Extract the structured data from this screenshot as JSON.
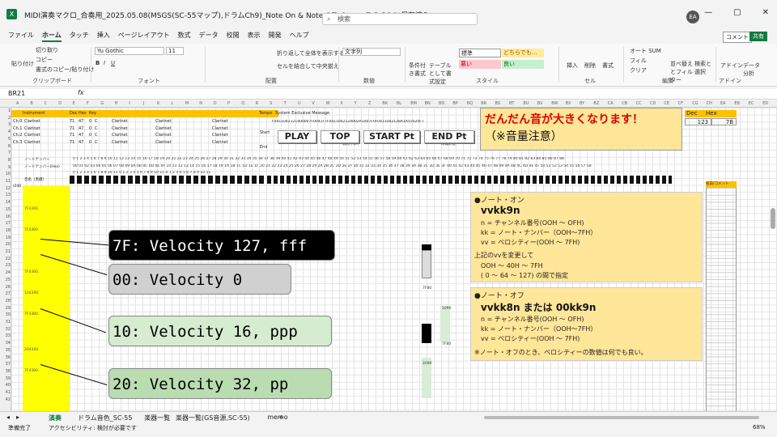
{
  "window": {
    "title": "MIDI演奏マクロ_合奏用_2025.05.08(MSGS(SC-55マップ),ドラムCh9)_Note On & Note Off.xlsm • この PC に保存済み",
    "search_placeholder": "検索",
    "user_initials": "EA"
  },
  "menu": {
    "tabs": [
      "ファイル",
      "ホーム",
      "タッチ",
      "挿入",
      "ページレイアウト",
      "数式",
      "データ",
      "校閲",
      "表示",
      "開発",
      "ヘルプ"
    ],
    "active": "ホーム",
    "comment_label": "コメント",
    "share_label": "共有"
  },
  "ribbon": {
    "paste": "貼り付け",
    "cut": "切り取り",
    "copy": "コピー",
    "format_painter": "書式のコピー/貼り付け",
    "clipboard": "クリップボード",
    "font_name": "Yu Gothic",
    "font_size": "11",
    "font_group": "フォント",
    "wrap_text": "折り返して全体を表示する",
    "merge_center": "セルを結合して中央揃え",
    "alignment": "配置",
    "number_format": "文字列",
    "number": "数値",
    "cond_format": "条件付き書式",
    "table_format": "テーブルとして書式設定",
    "style_standard": "標準",
    "style_neutral": "どちらでも...",
    "style_bad": "悪い",
    "style_good": "良い",
    "style": "スタイル",
    "insert": "挿入",
    "delete": "削除",
    "format": "書式",
    "cells": "セル",
    "autosum": "オート SUM",
    "fill": "フィル",
    "clear": "クリア",
    "sort_filter": "並べ替えとフィルター",
    "find_select": "検索と選択",
    "editing": "編集",
    "addin": "アドイン",
    "data_analysis": "データ分析"
  },
  "formula": {
    "cell_ref": "BR21",
    "fx": "fx",
    "content": ""
  },
  "sheet": {
    "col_headers": [
      "A",
      "B",
      "C",
      "D",
      "E",
      "F",
      "G",
      "H",
      "I",
      "J",
      "K",
      "L",
      "M",
      "N",
      "O",
      "P",
      "Q",
      "R",
      "S",
      "T",
      "U",
      "V",
      "W",
      "X",
      "Y",
      "Z",
      "BK",
      "BL",
      "BM",
      "BN",
      "BO",
      "BP",
      "BQ",
      "BR",
      "BS",
      "BT",
      "BU",
      "BV",
      "BW",
      "BX",
      "BY",
      "BZ",
      "CA",
      "CB",
      "CC",
      "CD",
      "CE",
      "CF",
      "CG",
      "CH",
      "EA",
      "EB",
      "EC",
      "ED"
    ],
    "row_numbers": [
      "1",
      "2",
      "3",
      "4",
      "5",
      "6",
      "7",
      "8",
      "9",
      "10",
      "11",
      "12",
      "13",
      "14",
      "15",
      "16",
      "17",
      "18",
      "19",
      "20",
      "21",
      "22",
      "23",
      "24",
      "25",
      "26",
      "27",
      "28",
      "29",
      "30",
      "31",
      "32",
      "33",
      "34",
      "35",
      "36",
      "37",
      "38",
      "39",
      "40",
      "41",
      "42"
    ],
    "table_header": {
      "instrument": "Instrument",
      "dec": "Dec",
      "hex": "Hex",
      "key": "Key",
      "tempo": "Tempo",
      "sysex": "System Exclusive Message"
    },
    "channels": [
      {
        "ch": "Ch.0",
        "inst": "Clarinet",
        "dec": "71",
        "hex": "47",
        "key": "0",
        "c": "C"
      },
      {
        "ch": "Ch.1",
        "inst": "Clarinet",
        "dec": "71",
        "hex": "47",
        "key": "0",
        "c": "C"
      },
      {
        "ch": "Ch.2",
        "inst": "Clarinet",
        "dec": "71",
        "hex": "47",
        "key": "0",
        "c": "C"
      },
      {
        "ch": "Ch.3",
        "inst": "Clarinet",
        "dec": "71",
        "hex": "47",
        "key": "0",
        "c": "C"
      }
    ],
    "tempo_start": "Start",
    "tempo_end": "End",
    "note_number_label": "ノートナンバー",
    "note_number_hex_label": "ノートナンバー(Hex)",
    "scale_label": "音名（黒鍵）",
    "row_label_11": "/240",
    "sysex_data": "F0411042121400007F0041F7F0411042124002A1007F0F0411042128A1A55020F7",
    "note_nums": "0 1 2 3 4 5 6 7 8 9 10 11 12 13 14 15 16 17 18 19 20 21 22 23 24 25 26 27 28 29 30 31 32 33 34 35 36 37 38 39 40 41 42 43 44 45 46 47 48 49 50 51 52 53 54 55 56 57 58 59 60 61 62 63 64 65 66 67 68 69 70 71 72 73 74 75 76 77 78 79 80 81 82 83 84 85 86 87 88",
    "note_hex": "00 01 02 03 04 05 06 07 08 09 0A 0B 0C 0D 0E 0F 10 11 12 13 14 15 16 17 18 19 1A 1B 1C 1D 1E 1F 20 21 22 23 24 25 26 27 28 29 2A 2B 2C 2D 2E 2F 30 31 32 33 34 35 36 37 38 39 3A 3B 3C 3D 3E 3F 40 41 42 43 44 45 46 47 48 49 4A 4B 4C 4D 4E 4F 50 51 52 53 54 55 56 57 58",
    "octave_row": "0 1 2 3 4 5 6 7 8 9 10 11 0 1 2 3 4 5 6 7 8 9 10 11 0 1 2 3 4 5 6 7 8 9 10 11",
    "middle_c_label": "真ん中のド",
    "tuning_label": "時報の音",
    "ylabels": [
      {
        "row": 15,
        "text": "7F4390."
      },
      {
        "row": 18,
        "text": "7F4380."
      },
      {
        "row": 24,
        "text": "7F4380."
      },
      {
        "row": 27,
        "text": "104390."
      },
      {
        "row": 30,
        "text": "7F4380."
      },
      {
        "row": 35,
        "text": "204390."
      },
      {
        "row": 38,
        "text": "7F4380."
      }
    ],
    "green_labels": [
      "7F9C",
      "7F80",
      "7F80",
      "1090",
      "2090"
    ],
    "orange_header": "名前/コメント"
  },
  "controls": {
    "play": "PLAY",
    "top": "TOP",
    "start_pt": "START Pt",
    "end_pt": "END Pt"
  },
  "warning": {
    "line1": "だんだん音が大きくなります！",
    "line2": "（※音量注意）"
  },
  "dechex": {
    "dec_label": "Dec",
    "hex_label": "Hex",
    "dec_value": "123",
    "hex_value": "7B"
  },
  "note_on": {
    "title": "●ノート・オン",
    "code": "vvkk9n",
    "n_line": "n  = チャンネル番号(OOH ～ OFH)",
    "kk_line": "kk = ノート・ナンバー（OOH～7FH）",
    "vv_line": "vv = ベロシティー(OOH ～ 7FH)",
    "note1": "上記のvvを変更して",
    "note2": "OOH ～ 40H ～ 7FH",
    "note3": "(  0   ～   64  ～ 127) の間で指定"
  },
  "note_off": {
    "title": "●ノート・オフ",
    "code": "vvkk8n または 00kk9n",
    "n_line": "n  = チャンネル番号(OOH ～ OFH)",
    "kk_line": "kk = ノート・ナンバー（OOH～7FH）",
    "vv_line": "vv = ベロシティー(OOH ～ 7FH)",
    "note": "※ノート・オフのとき、ベロシティーの数値は何でも良い。"
  },
  "callouts": [
    {
      "text": "7F: Velocity 127, fff",
      "bg": "#000000",
      "fg": "#ffffff"
    },
    {
      "text": "00: Velocity 0",
      "bg": "#d0d0d0",
      "fg": "#000000"
    },
    {
      "text": "10: Velocity 16, ppp",
      "bg": "#d5ecd0",
      "fg": "#000000"
    },
    {
      "text": "20: Velocity 32, pp",
      "bg": "#b9ddb0",
      "fg": "#000000"
    }
  ],
  "sheet_tabs": [
    "演奏",
    "ドラム音色_SC-55",
    "楽器一覧",
    "楽器一覧(GS音源,SC-55)",
    "memo"
  ],
  "active_tab": "演奏",
  "status": {
    "ready": "準備完了",
    "accessibility": "アクセシビリティ: 検討が必要です",
    "zoom": "68%"
  }
}
